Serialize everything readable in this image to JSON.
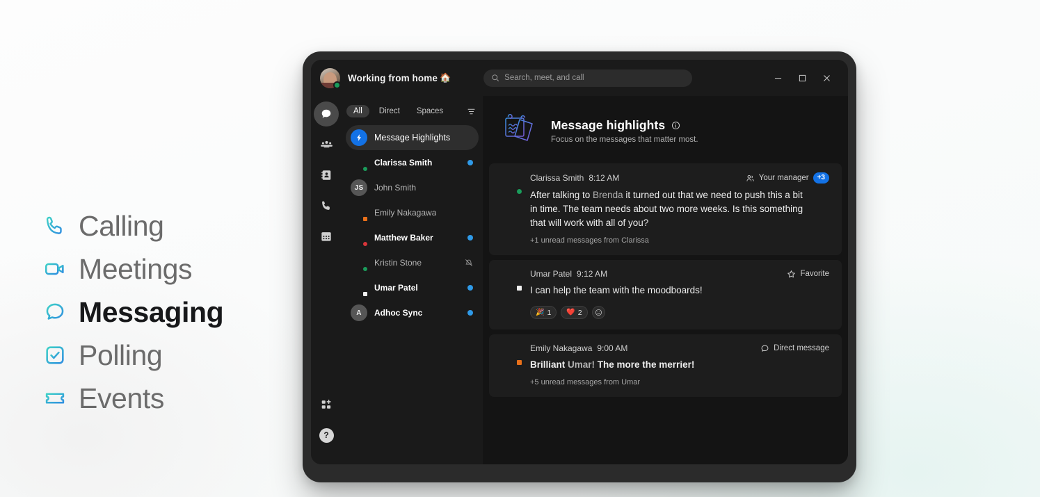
{
  "features": [
    {
      "label": "Calling",
      "icon": "phone-icon",
      "active": false
    },
    {
      "label": "Meetings",
      "icon": "video-icon",
      "active": false
    },
    {
      "label": "Messaging",
      "icon": "chat-icon",
      "active": true
    },
    {
      "label": "Polling",
      "icon": "poll-icon",
      "active": false
    },
    {
      "label": "Events",
      "icon": "ticket-icon",
      "active": false
    }
  ],
  "titlebar": {
    "status_text": "Working from home",
    "status_emoji": "🏠",
    "presence": "available",
    "search_placeholder": "Search, meet, and call",
    "window_controls": [
      {
        "name": "minimize-button",
        "glyph": "–"
      },
      {
        "name": "maximize-button",
        "glyph": "☐"
      },
      {
        "name": "close-button",
        "glyph": "✕"
      }
    ]
  },
  "rail": [
    {
      "name": "rail-messaging",
      "icon": "chat-bubble-icon",
      "active": true
    },
    {
      "name": "rail-teams",
      "icon": "people-icon",
      "active": false
    },
    {
      "name": "rail-contacts",
      "icon": "contact-card-icon",
      "active": false
    },
    {
      "name": "rail-calling",
      "icon": "phone-icon",
      "active": false
    },
    {
      "name": "rail-calendar",
      "icon": "calendar-icon",
      "active": false
    }
  ],
  "rail_bottom": [
    {
      "name": "rail-apps",
      "icon": "apps-add-icon"
    },
    {
      "name": "rail-help",
      "icon": "help-icon",
      "glyph": "?"
    }
  ],
  "filters": {
    "tabs": [
      {
        "label": "All",
        "active": true
      },
      {
        "label": "Direct",
        "active": false
      },
      {
        "label": "Spaces",
        "active": false
      }
    ],
    "filter_icon": "filter-icon"
  },
  "conversations": [
    {
      "name": "Message Highlights",
      "avatar": "bolt",
      "selected": true,
      "unread": false,
      "highlight": true,
      "presence": null,
      "right": "none"
    },
    {
      "name": "Clarissa Smith",
      "avatar": "photo-clarissa",
      "selected": false,
      "unread": true,
      "presence": "available",
      "right": "dot"
    },
    {
      "name": "John Smith",
      "avatar": "initials",
      "initials": "JS",
      "selected": false,
      "unread": false,
      "presence": null,
      "right": "none"
    },
    {
      "name": "Emily Nakagawa",
      "avatar": "photo-emily",
      "selected": false,
      "unread": false,
      "presence": "ooo",
      "right": "none"
    },
    {
      "name": "Matthew Baker",
      "avatar": "photo-matthew",
      "selected": false,
      "unread": true,
      "presence": "dnd",
      "right": "dot"
    },
    {
      "name": "Kristin Stone",
      "avatar": "photo-kristin",
      "selected": false,
      "unread": false,
      "presence": "available",
      "right": "mute"
    },
    {
      "name": "Umar Patel",
      "avatar": "photo-umar",
      "selected": false,
      "unread": true,
      "presence": "white",
      "right": "dot"
    },
    {
      "name": "Adhoc Sync",
      "avatar": "initials",
      "initials": "A",
      "selected": false,
      "unread": true,
      "presence": null,
      "right": "dot"
    }
  ],
  "highlights_header": {
    "art": "notes-illustration",
    "title": "Message highlights",
    "info_icon": "info-icon",
    "subtitle": "Focus on the messages that matter most."
  },
  "cards": [
    {
      "author": "Clarissa Smith",
      "time": "8:12 AM",
      "avatar": "photo-clarissa",
      "presence": "available",
      "tag_icon": "people-icon",
      "tag_label": "Your manager",
      "tag_count": "+3",
      "text_before": "After talking to ",
      "mention": "Brenda",
      "text_after": " it turned out that we need to push this a bit in time. The team needs about two more weeks. Is this something that will work with all of you?",
      "bold": false,
      "subtext": "+1 unread messages from Clarissa",
      "reactions": []
    },
    {
      "author": "Umar Patel",
      "time": "9:12 AM",
      "avatar": "photo-umar",
      "presence": "white",
      "tag_icon": "star-icon",
      "tag_label": "Favorite",
      "tag_count": null,
      "text_before": "I can help the team with the moodboards!",
      "mention": null,
      "text_after": "",
      "bold": false,
      "subtext": null,
      "reactions": [
        {
          "emoji": "🎉",
          "count": "1",
          "name": "reaction-party"
        },
        {
          "emoji": "❤️",
          "count": "2",
          "name": "reaction-heart"
        },
        {
          "emoji": "",
          "count": "",
          "name": "add-reaction-button"
        }
      ]
    },
    {
      "author": "Emily Nakagawa",
      "time": "9:00 AM",
      "avatar": "photo-emily",
      "presence": "ooo",
      "tag_icon": "chat-bubble-icon",
      "tag_label": "Direct message",
      "tag_count": null,
      "text_before": "Brilliant ",
      "mention": "Umar!",
      "text_after": " The more the merrier!",
      "bold": true,
      "subtext": "+5 unread messages from Umar",
      "reactions": []
    }
  ],
  "colors": {
    "accent_blue": "#1372e6",
    "unread_dot": "#2f9ae8",
    "available": "#1a9c5b",
    "dnd": "#d9353a",
    "ooo": "#e8701a",
    "panel": "#141414",
    "card": "#1d1d1d",
    "frame": "#2b2b2b"
  }
}
